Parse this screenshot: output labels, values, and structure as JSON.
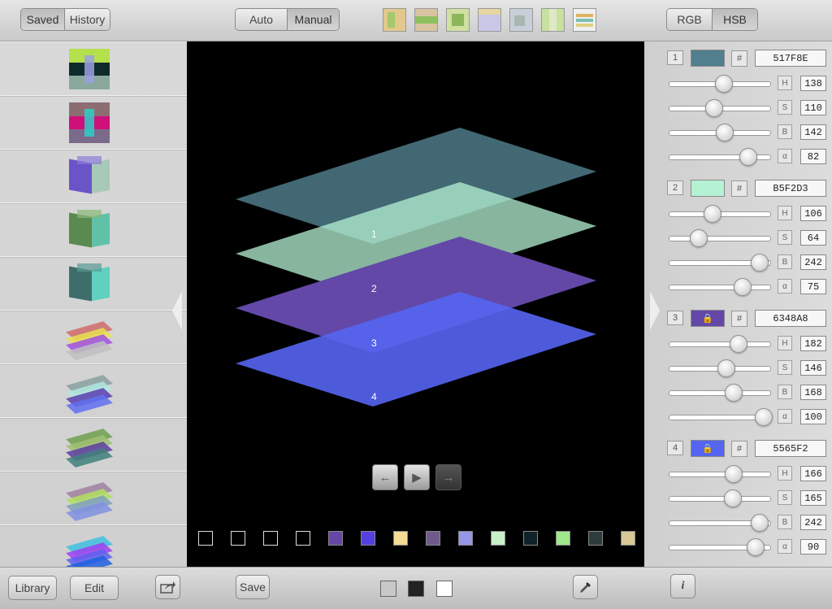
{
  "left": {
    "tabs": [
      "Saved",
      "History"
    ],
    "bottom": {
      "library": "Library",
      "edit": "Edit",
      "share_icon": "share-icon"
    }
  },
  "center": {
    "mode_tabs": [
      "Auto",
      "Manual"
    ],
    "save_label": "Save",
    "layer_labels": [
      "1",
      "2",
      "3",
      "4"
    ],
    "nav_icons": [
      "arrow-left-icon",
      "play-icon",
      "arrow-right-icon"
    ],
    "swatches": [
      "#000000",
      "#000000",
      "#000000",
      "#000000",
      "#6348a8",
      "#5541e0",
      "#f5dc96",
      "#6e5a8c",
      "#9696e6",
      "#c8f0c8",
      "#0f2328",
      "#a0e68c",
      "#2d3c3c",
      "#d7c896"
    ]
  },
  "right": {
    "modes": [
      "RGB",
      "HSB"
    ],
    "layers": [
      {
        "num": "1",
        "hex": "517F8E",
        "color": "#517f8e",
        "locked": false,
        "h": "138",
        "s": "110",
        "b": "142",
        "a": "82"
      },
      {
        "num": "2",
        "hex": "B5F2D3",
        "color": "#b5f2d3",
        "locked": false,
        "h": "106",
        "s": "64",
        "b": "242",
        "a": "75"
      },
      {
        "num": "3",
        "hex": "6348A8",
        "color": "#6348a8",
        "locked": true,
        "h": "182",
        "s": "146",
        "b": "168",
        "a": "100"
      },
      {
        "num": "4",
        "hex": "5565F2",
        "color": "#5565f2",
        "locked": true,
        "h": "166",
        "s": "165",
        "b": "242",
        "a": "90"
      }
    ],
    "channel_labels": [
      "H",
      "S",
      "B",
      "α"
    ],
    "hash": "#",
    "info_icon": "i"
  }
}
